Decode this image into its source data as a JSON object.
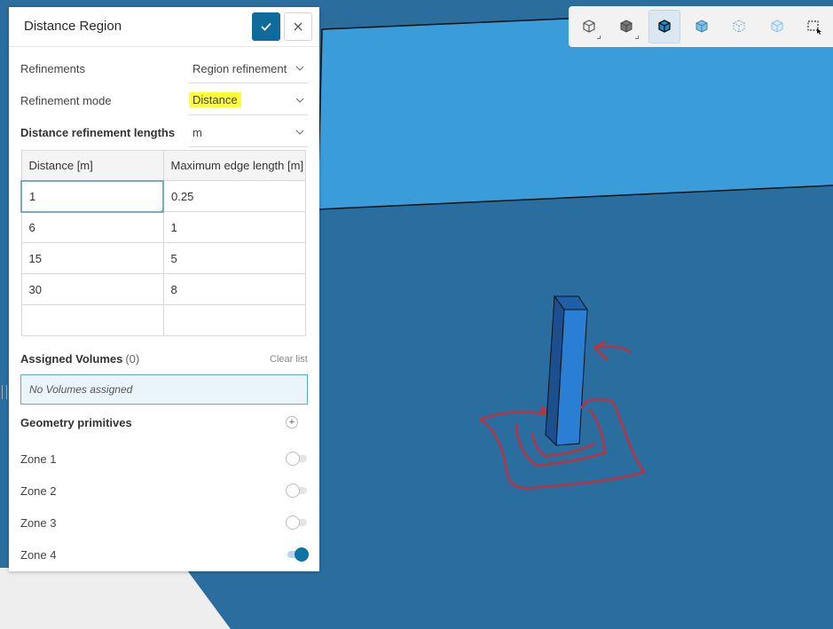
{
  "panel": {
    "title": "Distance Region",
    "refinements_label": "Refinements",
    "refinements_value": "Region refinement",
    "mode_label": "Refinement mode",
    "mode_value": "Distance",
    "lengths_label": "Distance refinement lengths",
    "lengths_unit": "m"
  },
  "table": {
    "headers": [
      "Distance [m]",
      "Maximum edge length [m]"
    ],
    "rows": [
      [
        "1",
        "0.25"
      ],
      [
        "6",
        "1"
      ],
      [
        "15",
        "5"
      ],
      [
        "30",
        "8"
      ],
      [
        "",
        ""
      ]
    ]
  },
  "assigned": {
    "label": "Assigned Volumes",
    "count": "(0)",
    "clear": "Clear list",
    "empty_text": "No Volumes assigned"
  },
  "geometry": {
    "label": "Geometry primitives",
    "zones": [
      {
        "label": "Zone 1",
        "on": false
      },
      {
        "label": "Zone 2",
        "on": false
      },
      {
        "label": "Zone 3",
        "on": false
      },
      {
        "label": "Zone 4",
        "on": true
      }
    ]
  },
  "toolbar": {
    "icons": [
      "wireframe-cube-icon",
      "solid-cube-icon",
      "shaded-edges-cube-icon",
      "transparent-cube-icon",
      "points-cube-icon",
      "ghost-cube-icon",
      "box-select-icon"
    ]
  },
  "colors": {
    "accent": "#0e6b9b",
    "highlight": "#ffff33",
    "sky_face": "#3a9cd8",
    "ground_face": "#2a6ea0",
    "annotation": "#d9262b",
    "column": "#2a7fd4"
  }
}
